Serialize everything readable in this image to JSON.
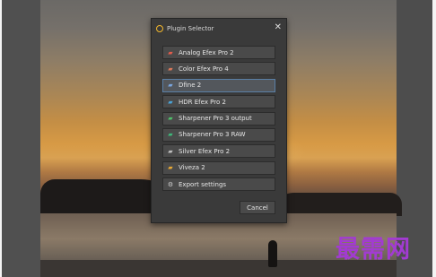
{
  "dialog": {
    "title": "Plugin Selector",
    "close_symbol": "✕",
    "items": [
      {
        "label": "Analog Efex Pro 2",
        "icon": "analog-efex-icon",
        "color": "#e25c4c"
      },
      {
        "label": "Color Efex Pro 4",
        "icon": "color-efex-icon",
        "color": "#d9785a"
      },
      {
        "label": "Dfine 2",
        "icon": "dfine-icon",
        "color": "#7aa6e0"
      },
      {
        "label": "HDR Efex Pro 2",
        "icon": "hdr-efex-icon",
        "color": "#4aa3d6"
      },
      {
        "label": "Sharpener Pro 3 output",
        "icon": "sharpener-output-icon",
        "color": "#4fc06a"
      },
      {
        "label": "Sharpener Pro 3 RAW",
        "icon": "sharpener-raw-icon",
        "color": "#3fb87a"
      },
      {
        "label": "Silver Efex Pro 2",
        "icon": "silver-efex-icon",
        "color": "#bfbfbf"
      },
      {
        "label": "Viveza 2",
        "icon": "viveza-icon",
        "color": "#e8a935"
      },
      {
        "label": "Export settings",
        "icon": "gear-icon",
        "color": "#cfcfcf"
      }
    ],
    "selected_index": 2,
    "cancel_label": "Cancel"
  },
  "watermark": "最需网"
}
